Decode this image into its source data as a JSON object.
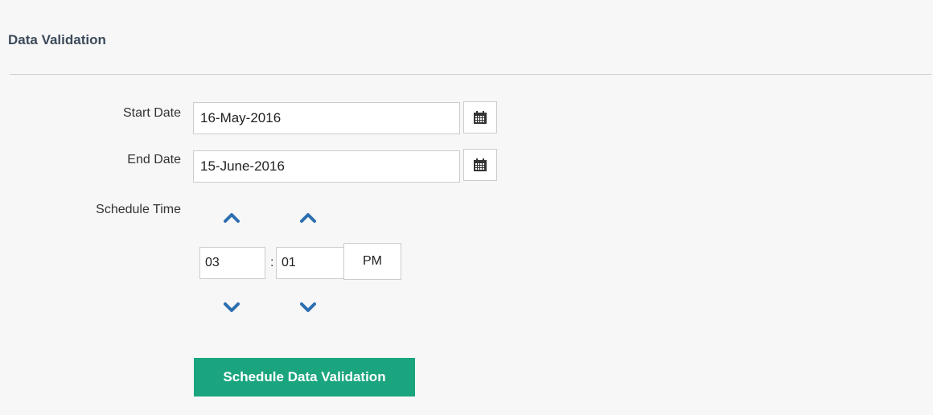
{
  "panel": {
    "title": "Data Validation"
  },
  "form": {
    "start_date": {
      "label": "Start Date",
      "value": "16-May-2016"
    },
    "end_date": {
      "label": "End Date",
      "value": "15-June-2016"
    },
    "schedule_time": {
      "label": "Schedule Time",
      "hour": "03",
      "separator": ":",
      "minute": "01",
      "meridiem": "PM"
    },
    "submit_label": "Schedule Data Validation"
  },
  "colors": {
    "accent": "#1aa57f",
    "chevron": "#2e6fb0",
    "title": "#3c4a5a"
  },
  "icons": {
    "calendar": "calendar-icon",
    "increment": "chevron-up-icon",
    "decrement": "chevron-down-icon"
  }
}
